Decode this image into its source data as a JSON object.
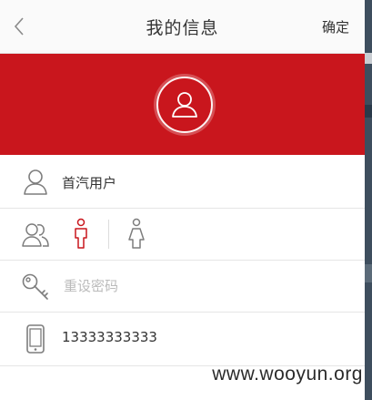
{
  "header": {
    "title": "我的信息",
    "confirm_label": "确定",
    "back_icon": "chevron-left-icon"
  },
  "banner": {
    "avatar_icon": "user-avatar-icon"
  },
  "form": {
    "name": {
      "icon": "user-icon",
      "value": "首汽用户"
    },
    "gender": {
      "icon": "users-icon",
      "male_icon": "male-icon",
      "female_icon": "female-icon",
      "selected": "male"
    },
    "password": {
      "icon": "key-icon",
      "placeholder": "重设密码"
    },
    "phone": {
      "icon": "phone-icon",
      "value": "13333333333"
    }
  },
  "watermark": "www.wooyun.org",
  "colors": {
    "accent": "#c9161d",
    "icon_gray": "#7d7d7d",
    "text": "#333333",
    "placeholder": "#bbbbbb"
  }
}
